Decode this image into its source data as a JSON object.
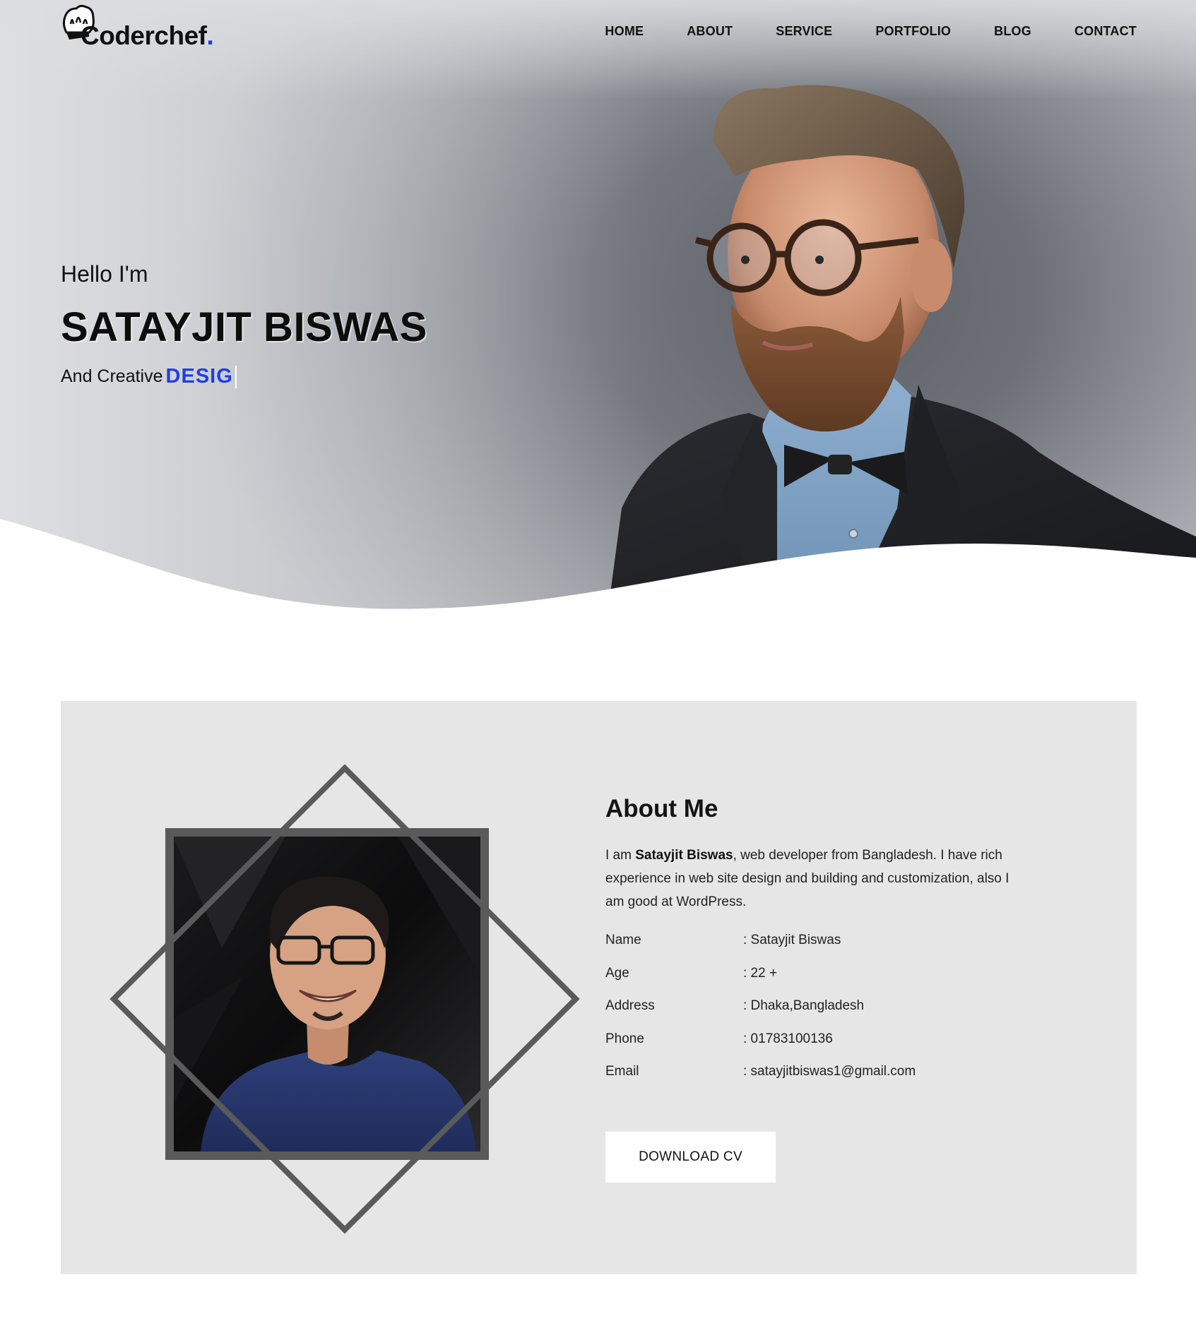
{
  "brand": {
    "name": "Coderchef",
    "dot": ".",
    "accent_color": "#1f3de6",
    "icon": "chef-hat-icon"
  },
  "nav": {
    "items": [
      {
        "label": "HOME"
      },
      {
        "label": "ABOUT"
      },
      {
        "label": "SERVICE"
      },
      {
        "label": "PORTFOLIO"
      },
      {
        "label": "BLOG"
      },
      {
        "label": "CONTACT"
      }
    ]
  },
  "hero": {
    "greeting": "Hello I'm",
    "name": "SATAYJIT BISWAS",
    "tagline_prefix": "And Creative",
    "tagline_role": "DESIG"
  },
  "about": {
    "title": "About Me",
    "desc_prefix": "I am ",
    "desc_name": "Satayjit Biswas",
    "desc_suffix": ", web developer from Bangladesh. I have rich experience in web site design and building and customization, also I am good at WordPress.",
    "info": [
      {
        "label": "Name",
        "value": ": Satayjit Biswas"
      },
      {
        "label": "Age",
        "value": ": 22 +"
      },
      {
        "label": "Address",
        "value": ": Dhaka,Bangladesh"
      },
      {
        "label": "Phone",
        "value": ": 01783100136"
      },
      {
        "label": "Email",
        "value": ": satayjitbiswas1@gmail.com"
      }
    ],
    "cv_button": "DOWNLOAD CV"
  }
}
